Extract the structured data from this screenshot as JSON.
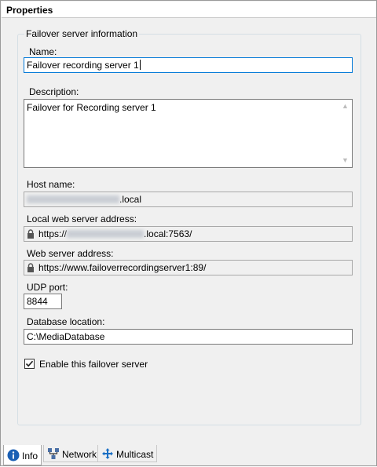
{
  "window": {
    "title": "Properties"
  },
  "group": {
    "title": "Failover server information"
  },
  "name": {
    "label": "Name:",
    "value": "Failover recording server 1"
  },
  "description": {
    "label": "Description:",
    "value": "Failover for Recording server 1"
  },
  "host_name": {
    "label": "Host name:",
    "suffix": ".local"
  },
  "local_web": {
    "label": "Local web server address:",
    "prefix": "https://",
    "suffix": ".local:7563/"
  },
  "web_server": {
    "label": "Web server address:",
    "value": "https://www.failoverrecordingserver1:89/"
  },
  "udp_port": {
    "label": "UDP port:",
    "value": "8844"
  },
  "database": {
    "label": "Database location:",
    "value": "C:\\MediaDatabase"
  },
  "enable": {
    "label": "Enable this failover server",
    "checked": true
  },
  "tabs": [
    {
      "label": "Info",
      "icon": "info-icon",
      "active": true
    },
    {
      "label": "Network",
      "icon": "network-icon",
      "active": false
    },
    {
      "label": "Multicast",
      "icon": "multicast-icon",
      "active": false
    }
  ]
}
